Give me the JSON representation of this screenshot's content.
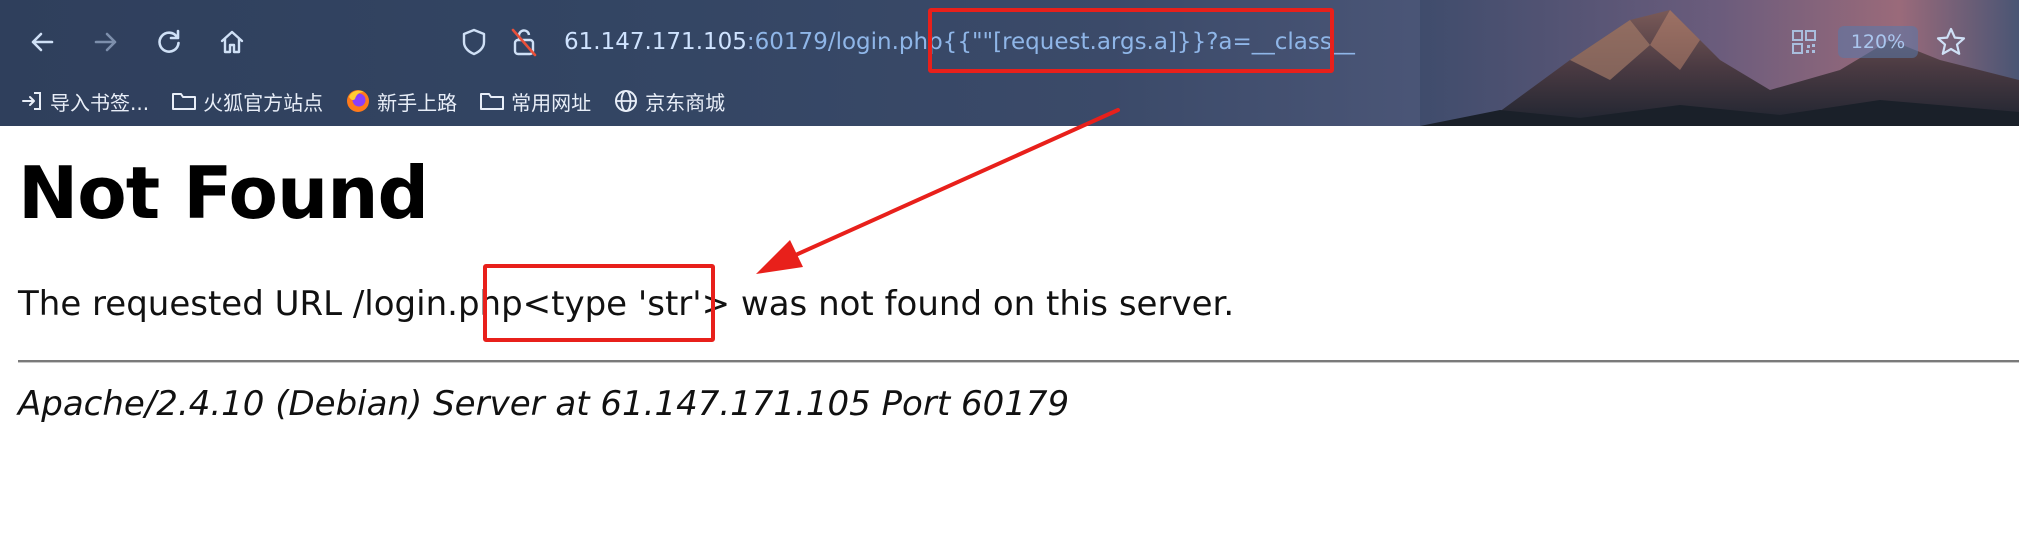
{
  "browser": {
    "url_host": "61.147.171.105",
    "url_rest": ":60179/login.php{{\"\"[request.args.a]}}?a=__class__",
    "zoom": "120%",
    "bookmarks": [
      {
        "label": "导入书签...",
        "icon": "import-icon"
      },
      {
        "label": "火狐官方站点",
        "icon": "folder-icon"
      },
      {
        "label": "新手上路",
        "icon": "firefox-icon"
      },
      {
        "label": "常用网址",
        "icon": "folder-icon"
      },
      {
        "label": "京东商城",
        "icon": "globe-icon"
      }
    ]
  },
  "page": {
    "title": "Not Found",
    "message": "The requested URL /login.php<type 'str'> was not found on this server.",
    "server_signature": "Apache/2.4.10 (Debian) Server at 61.147.171.105 Port 60179"
  },
  "annotations": {
    "color": "#e8201b"
  }
}
